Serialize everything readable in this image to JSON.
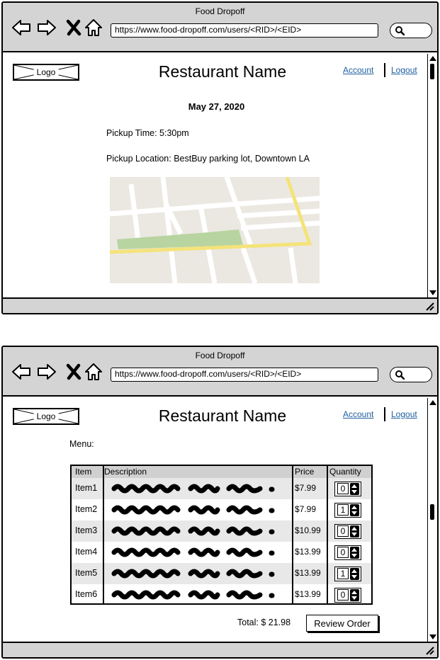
{
  "windows": [
    {
      "title": "Food Dropoff",
      "url": "https://www.food-dropoff.com/users/<RID>/<EID>",
      "page": {
        "logo_label": "Logo",
        "restaurant_name": "Restaurant Name",
        "account_link": "Account",
        "logout_link": "Logout",
        "date": "May 27, 2020",
        "pickup_time": "Pickup Time: 5:30pm",
        "pickup_location": "Pickup Location: BestBuy parking lot, Downtown LA"
      }
    },
    {
      "title": "Food Dropoff",
      "url": "https://www.food-dropoff.com/users/<RID>/<EID>",
      "page": {
        "logo_label": "Logo",
        "restaurant_name": "Restaurant Name",
        "account_link": "Account",
        "logout_link": "Logout",
        "menu_label": "Menu:",
        "table": {
          "headers": [
            "Item",
            "Description",
            "Price",
            "Quantity"
          ],
          "rows": [
            {
              "item": "Item1",
              "price": "$7.99",
              "quantity": "0"
            },
            {
              "item": "Item2",
              "price": "$7.99",
              "quantity": "1"
            },
            {
              "item": "Item3",
              "price": "$10.99",
              "quantity": "0"
            },
            {
              "item": "Item4",
              "price": "$13.99",
              "quantity": "0"
            },
            {
              "item": "Item5",
              "price": "$13.99",
              "quantity": "1"
            },
            {
              "item": "Item6",
              "price": "$13.99",
              "quantity": "0"
            }
          ]
        },
        "total": "Total: $ 21.98",
        "review_button": "Review Order"
      }
    }
  ],
  "icons": {
    "back": "arrow-left-icon",
    "forward": "arrow-right-icon",
    "stop": "close-icon",
    "home": "home-icon",
    "search": "search-icon",
    "resize": "resize-grip-icon"
  },
  "colors": {
    "chrome": "#d4d4d4",
    "link": "#1f5f9f",
    "map_road_major": "#f4e37a",
    "map_park": "#b8d4a0",
    "map_land": "#ebe8e2"
  }
}
